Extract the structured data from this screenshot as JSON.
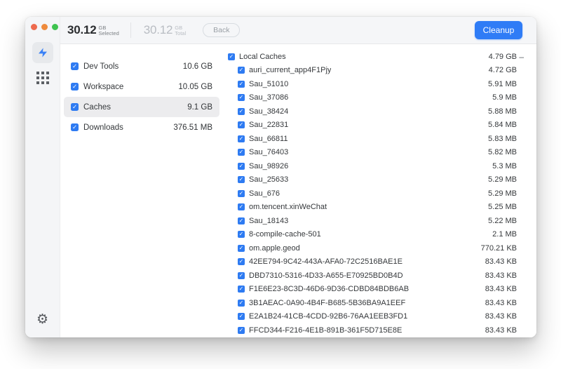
{
  "colors": {
    "accent_blue": "#2F7CF6",
    "traffic_close": "#ED6A4E",
    "traffic_minimize": "#EE8A3C",
    "traffic_zoom": "#3EC34F",
    "selected_row_bg": "#ECECEE",
    "sidebar_bg": "#F4F5F7"
  },
  "header": {
    "selected": {
      "value": "30.12",
      "unit": "GB",
      "label": "Selected"
    },
    "total": {
      "value": "30.12",
      "unit": "GB",
      "label": "Total"
    },
    "back_label": "Back",
    "cleanup_label": "Cleanup"
  },
  "sidebar": {
    "icons": [
      "lightning-icon",
      "grid-icon"
    ],
    "settings_icon": "gear-icon",
    "gear_glyph": "⚙"
  },
  "checkbox_glyph": "✓",
  "categories": [
    {
      "label": "Dev Tools",
      "size": "10.6 GB",
      "checked": true,
      "selected": false
    },
    {
      "label": "Workspace",
      "size": "10.05 GB",
      "checked": true,
      "selected": false
    },
    {
      "label": "Caches",
      "size": "9.1 GB",
      "checked": true,
      "selected": true
    },
    {
      "label": "Downloads",
      "size": "376.51 MB",
      "checked": true,
      "selected": false
    }
  ],
  "files": [
    {
      "label": "Local Caches",
      "size": "4.79 GB",
      "checked": true,
      "indent": false,
      "collapse": "–"
    },
    {
      "label": "auri_current_app4F1Pjy",
      "size": "4.72 GB",
      "checked": true,
      "indent": true
    },
    {
      "label": "Sau_51010",
      "size": "5.91 MB",
      "checked": true,
      "indent": true
    },
    {
      "label": "Sau_37086",
      "size": "5.9 MB",
      "checked": true,
      "indent": true
    },
    {
      "label": "Sau_38424",
      "size": "5.88 MB",
      "checked": true,
      "indent": true
    },
    {
      "label": "Sau_22831",
      "size": "5.84 MB",
      "checked": true,
      "indent": true
    },
    {
      "label": "Sau_66811",
      "size": "5.83 MB",
      "checked": true,
      "indent": true
    },
    {
      "label": "Sau_76403",
      "size": "5.82 MB",
      "checked": true,
      "indent": true
    },
    {
      "label": "Sau_98926",
      "size": "5.3 MB",
      "checked": true,
      "indent": true
    },
    {
      "label": "Sau_25633",
      "size": "5.29 MB",
      "checked": true,
      "indent": true
    },
    {
      "label": "Sau_676",
      "size": "5.29 MB",
      "checked": true,
      "indent": true
    },
    {
      "label": "om.tencent.xinWeChat",
      "size": "5.25 MB",
      "checked": true,
      "indent": true
    },
    {
      "label": "Sau_18143",
      "size": "5.22 MB",
      "checked": true,
      "indent": true
    },
    {
      "label": "8-compile-cache-501",
      "size": "2.1 MB",
      "checked": true,
      "indent": true
    },
    {
      "label": "om.apple.geod",
      "size": "770.21 KB",
      "checked": true,
      "indent": true
    },
    {
      "label": "42EE794-9C42-443A-AFA0-72C2516BAE1E",
      "size": "83.43 KB",
      "checked": true,
      "indent": true
    },
    {
      "label": "DBD7310-5316-4D33-A655-E70925BD0B4D",
      "size": "83.43 KB",
      "checked": true,
      "indent": true
    },
    {
      "label": "F1E6E23-8C3D-46D6-9D36-CDBD84BDB6AB",
      "size": "83.43 KB",
      "checked": true,
      "indent": true
    },
    {
      "label": "3B1AEAC-0A90-4B4F-B685-5B36BA9A1EEF",
      "size": "83.43 KB",
      "checked": true,
      "indent": true
    },
    {
      "label": "E2A1B24-41CB-4CDD-92B6-76AA1EEB3FD1",
      "size": "83.43 KB",
      "checked": true,
      "indent": true
    },
    {
      "label": "FFCD344-F216-4E1B-891B-361F5D715E8E",
      "size": "83.43 KB",
      "checked": true,
      "indent": true
    }
  ]
}
